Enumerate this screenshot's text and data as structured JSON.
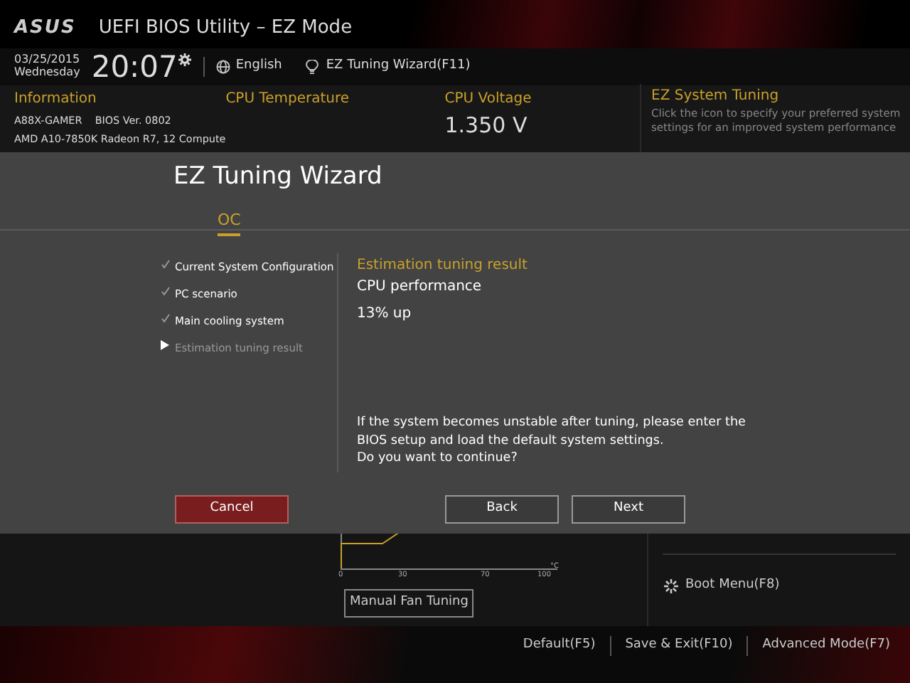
{
  "header": {
    "brand": "ASUS",
    "title": "UEFI BIOS Utility – EZ Mode",
    "date": "03/25/2015",
    "weekday": "Wednesday",
    "time": "20:07",
    "language": "English",
    "wizard_link": "EZ Tuning Wizard(F11)"
  },
  "info_panel": {
    "information": {
      "title": "Information",
      "lines": [
        "A88X-GAMER    BIOS Ver. 0802",
        "AMD A10-7850K Radeon R7, 12 Compute"
      ]
    },
    "cpu_temperature": {
      "title": "CPU Temperature"
    },
    "cpu_voltage": {
      "title": "CPU Voltage",
      "value": "1.350 V"
    },
    "ez_system_tuning": {
      "title": "EZ System Tuning",
      "description": [
        "Click the icon to specify your preferred system",
        "settings for an improved system performance"
      ]
    }
  },
  "fan_chart": {
    "tick_labels": [
      "0",
      "30",
      "70",
      "100"
    ],
    "unit": "°C",
    "button": "Manual Fan Tuning"
  },
  "boot_menu": "Boot Menu(F8)",
  "footer": [
    "Default(F5)",
    "Save & Exit(F10)",
    "Advanced Mode(F7)"
  ],
  "wizard": {
    "title": "EZ Tuning Wizard",
    "tabs": [
      {
        "label": "OC",
        "selected": true
      }
    ],
    "steps": [
      {
        "label": "Current System Configuration",
        "kind": "done"
      },
      {
        "label": "PC scenario",
        "kind": "done"
      },
      {
        "label": "Main cooling system",
        "kind": "done"
      },
      {
        "label": "Estimation tuning result",
        "kind": "current"
      }
    ],
    "result_heading": "Estimation tuning result",
    "result_label": "CPU performance",
    "result_value": "13% up",
    "warning": [
      "If the system becomes unstable after tuning, please enter the",
      "BIOS setup and load the default system settings.",
      "Do you want to continue?"
    ],
    "buttons": [
      {
        "label": "Cancel",
        "kind": "cancel"
      },
      {
        "label": "Back",
        "kind": "normal"
      },
      {
        "label": "Next",
        "kind": "normal"
      }
    ]
  }
}
